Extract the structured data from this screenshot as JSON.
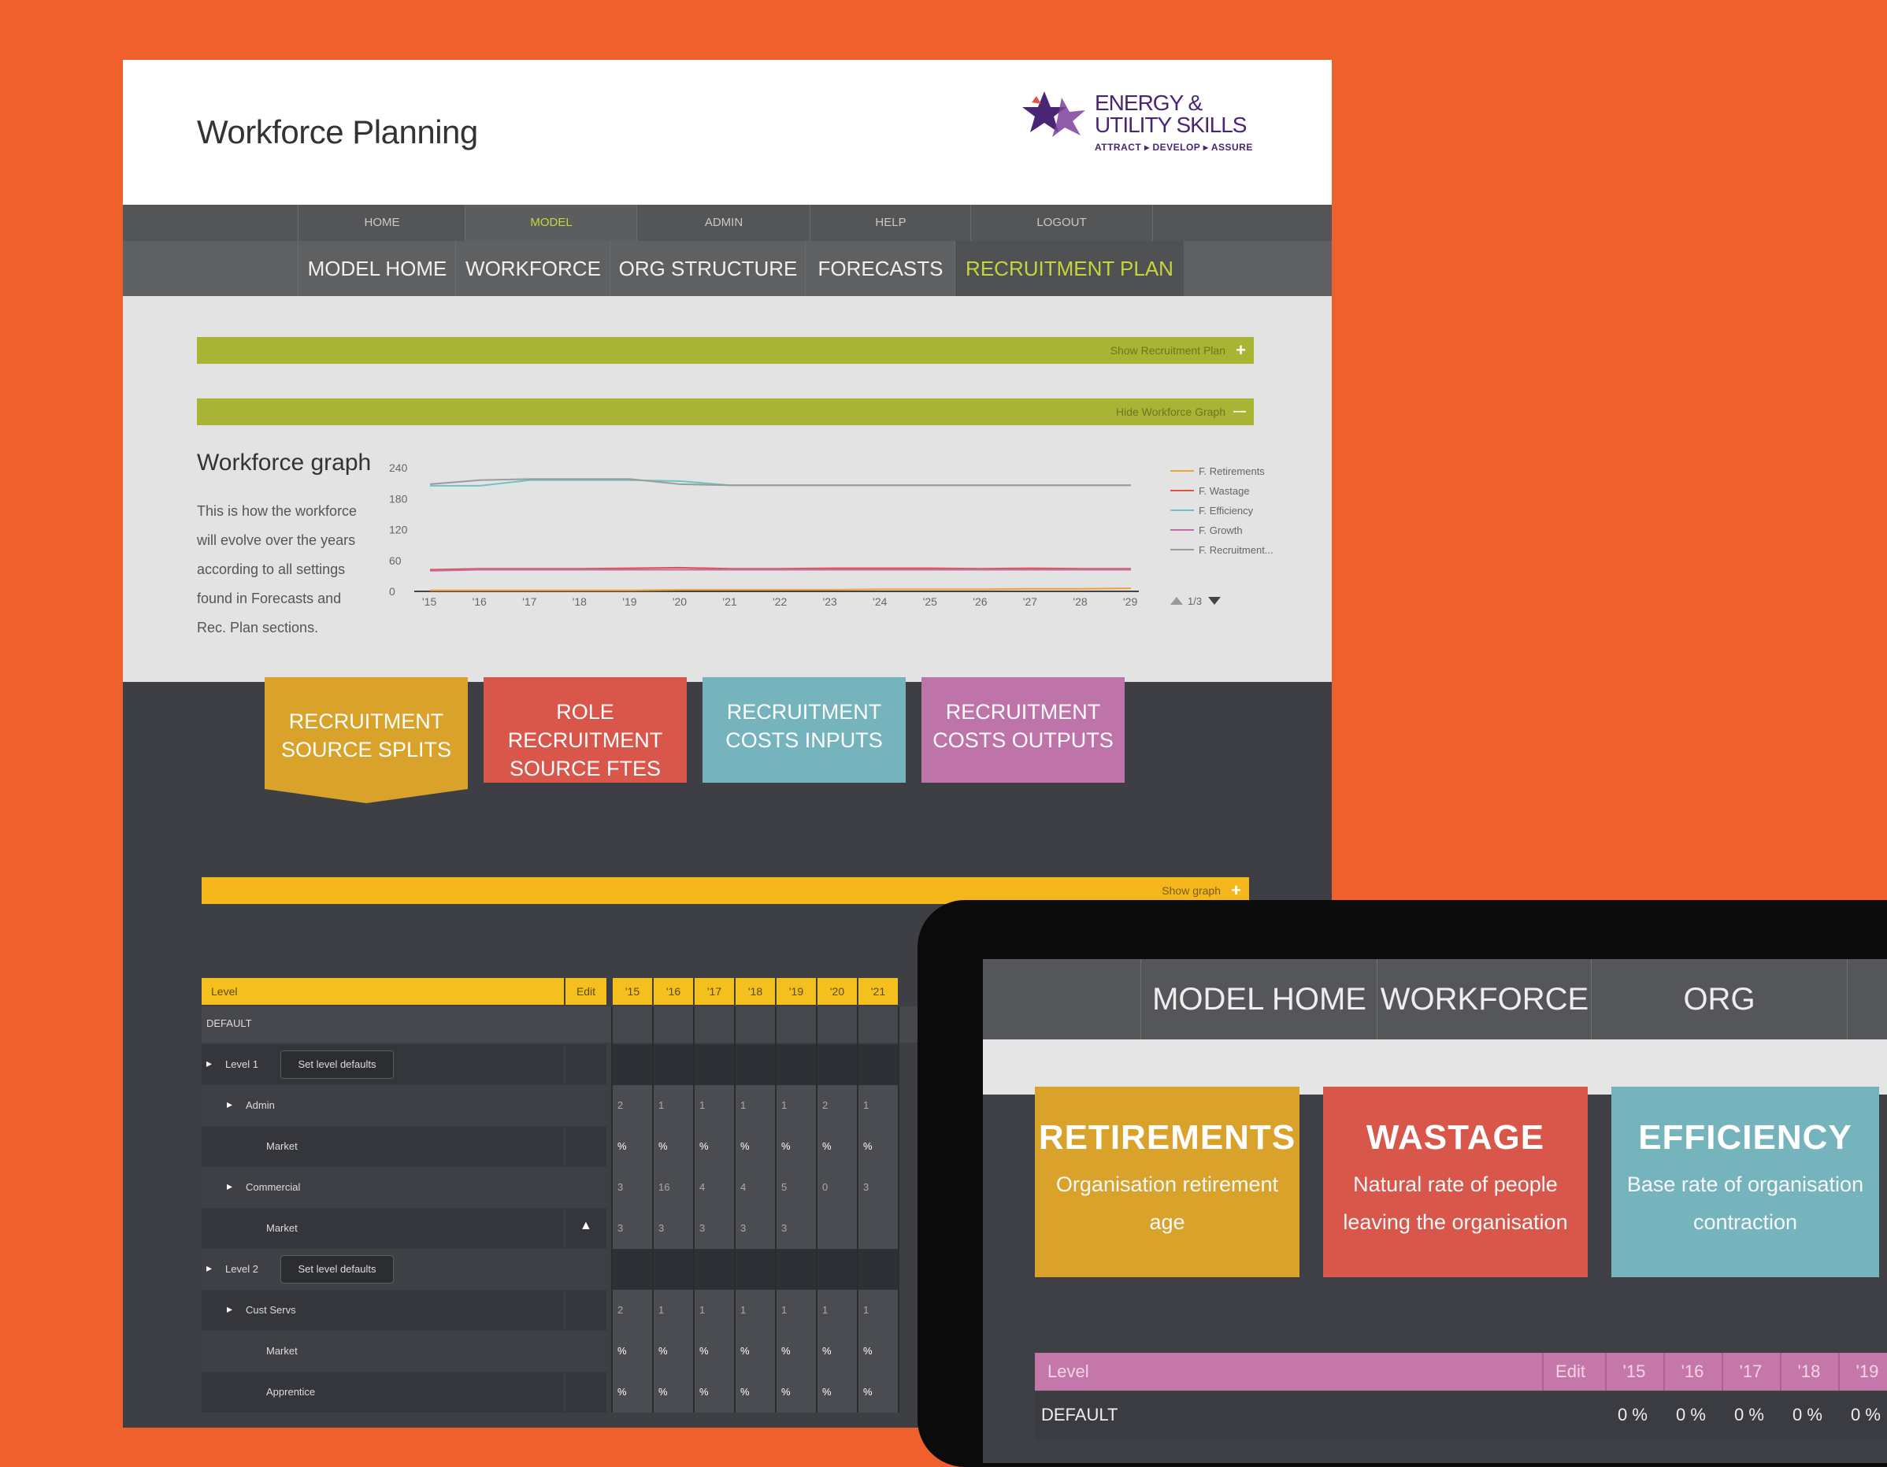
{
  "app": {
    "title": "Workforce Planning"
  },
  "logo": {
    "line1": "ENERGY &",
    "line2": "UTILITY SKILLS",
    "tagline": "ATTRACT ▸ DEVELOP ▸ ASSURE"
  },
  "top_nav": [
    {
      "label": "HOME"
    },
    {
      "label": "MODEL"
    },
    {
      "label": "ADMIN"
    },
    {
      "label": "HELP"
    },
    {
      "label": "LOGOUT"
    }
  ],
  "main_nav": [
    {
      "label": "MODEL HOME"
    },
    {
      "label": "WORKFORCE"
    },
    {
      "label": "ORG STRUCTURE"
    },
    {
      "label": "FORECASTS"
    },
    {
      "label": "RECRUITMENT PLAN"
    }
  ],
  "bars": {
    "show_recruitment": "Show Recruitment Plan",
    "hide_graph": "Hide Workforce Graph",
    "show_graph": "Show graph",
    "plus": "+",
    "minus": "—"
  },
  "graph": {
    "title": "Workforce graph",
    "desc": [
      "This is how the workforce",
      "will evolve over the years",
      "according to all settings",
      "found in Forecasts and",
      "Rec. Plan sections."
    ],
    "pager": "1/3"
  },
  "chart_data": {
    "type": "line",
    "x": [
      "'15",
      "'16",
      "'17",
      "'18",
      "'19",
      "'20",
      "'21",
      "'22",
      "'23",
      "'24",
      "'25",
      "'26",
      "'27",
      "'28",
      "'29"
    ],
    "ylim": [
      0,
      240
    ],
    "yticks": [
      "0",
      "60",
      "120",
      "180",
      "240"
    ],
    "series": [
      {
        "name": "F. Retirements",
        "color": "#f0a23a",
        "values": [
          2,
          2,
          2,
          2,
          2,
          3,
          3,
          3,
          3,
          4,
          4,
          4,
          5,
          5,
          6
        ]
      },
      {
        "name": "F. Wastage",
        "color": "#e2544a",
        "values": [
          42,
          44,
          44,
          44,
          45,
          46,
          44,
          44,
          45,
          45,
          45,
          44,
          45,
          44,
          44
        ]
      },
      {
        "name": "F. Efficiency",
        "color": "#6fc2c6",
        "values": [
          205,
          205,
          216,
          216,
          216,
          214,
          206,
          206,
          206,
          206,
          206,
          206,
          206,
          206,
          206
        ]
      },
      {
        "name": "F. Growth",
        "color": "#c46ba7",
        "values": [
          40,
          42,
          42,
          42,
          42,
          42,
          42,
          42,
          42,
          42,
          42,
          42,
          42,
          42,
          42
        ]
      },
      {
        "name": "F. Recruitment...",
        "color": "#9b9b9b",
        "values": [
          208,
          216,
          218,
          218,
          218,
          208,
          206,
          206,
          206,
          206,
          206,
          206,
          206,
          206,
          206
        ]
      }
    ]
  },
  "tabs": [
    {
      "line1": "RECRUITMENT",
      "line2": "SOURCE SPLITS",
      "color": "#d9a22b"
    },
    {
      "line1": "ROLE RECRUITMENT",
      "line2": "SOURCE FTES",
      "color": "#d8564a"
    },
    {
      "line1": "RECRUITMENT",
      "line2": "COSTS INPUTS",
      "color": "#75b4bd"
    },
    {
      "line1": "RECRUITMENT",
      "line2": "COSTS OUTPUTS",
      "color": "#be74a9"
    }
  ],
  "grid": {
    "level_header": "Level",
    "edit_header": "Edit",
    "years": [
      "'15",
      "'16",
      "'17",
      "'18",
      "'19",
      "'20",
      "'21"
    ],
    "default_label": "DEFAULT",
    "set_defaults": "Set level defaults",
    "rows": [
      {
        "label": "Level 1",
        "indent": 0,
        "arrow": "▸",
        "button": true,
        "cells": [
          "",
          "",
          "",
          "",
          "",
          "",
          ""
        ]
      },
      {
        "label": "Admin",
        "indent": 1,
        "arrow": "▸",
        "button": false,
        "cells": [
          "2",
          "1",
          "1",
          "1",
          "1",
          "2",
          "1"
        ]
      },
      {
        "label": "Market",
        "indent": 2,
        "arrow": "",
        "button": false,
        "cells": [
          "%",
          "%",
          "%",
          "%",
          "%",
          "%",
          "%"
        ]
      },
      {
        "label": "Commercial",
        "indent": 1,
        "arrow": "▸",
        "button": false,
        "cells": [
          "3",
          "16",
          "4",
          "4",
          "5",
          "0",
          "3"
        ]
      },
      {
        "label": "Market",
        "indent": 2,
        "arrow": "",
        "button": false,
        "warn": true,
        "cells": [
          "3",
          "3",
          "3",
          "3",
          "3",
          "",
          ""
        ]
      },
      {
        "label": "Level 2",
        "indent": 0,
        "arrow": "▸",
        "button": true,
        "cells": [
          "",
          "",
          "",
          "",
          "",
          "",
          ""
        ]
      },
      {
        "label": "Cust Servs",
        "indent": 1,
        "arrow": "▸",
        "button": false,
        "cells": [
          "2",
          "1",
          "1",
          "1",
          "1",
          "1",
          "1"
        ]
      },
      {
        "label": "Market",
        "indent": 2,
        "arrow": "",
        "button": false,
        "cells": [
          "%",
          "%",
          "%",
          "%",
          "%",
          "%",
          "%"
        ]
      },
      {
        "label": "Apprentice",
        "indent": 2,
        "arrow": "",
        "button": false,
        "cells": [
          "%",
          "%",
          "%",
          "%",
          "%",
          "%",
          "%"
        ]
      }
    ]
  },
  "tablet": {
    "nav": [
      {
        "label": "MODEL HOME"
      },
      {
        "label": "WORKFORCE"
      },
      {
        "label": "ORG STRUCTURE"
      }
    ],
    "cards": [
      {
        "title": "RETIREMENTS",
        "sub1": "Organisation retirement",
        "sub2": "age",
        "color": "#d9a22b"
      },
      {
        "title": "WASTAGE",
        "sub1": "Natural rate of people",
        "sub2": "leaving the organisation",
        "color": "#d8564a"
      },
      {
        "title": "EFFICIENCY",
        "sub1": "Base rate of organisation",
        "sub2": "contraction",
        "color": "#75b4bd"
      }
    ],
    "grid": {
      "level_header": "Level",
      "edit_header": "Edit",
      "years": [
        "'15",
        "'16",
        "'17",
        "'18",
        "'19"
      ],
      "default_label": "DEFAULT",
      "default_values": [
        "0 %",
        "0 %",
        "0 %",
        "0 %",
        "0 %"
      ]
    }
  }
}
